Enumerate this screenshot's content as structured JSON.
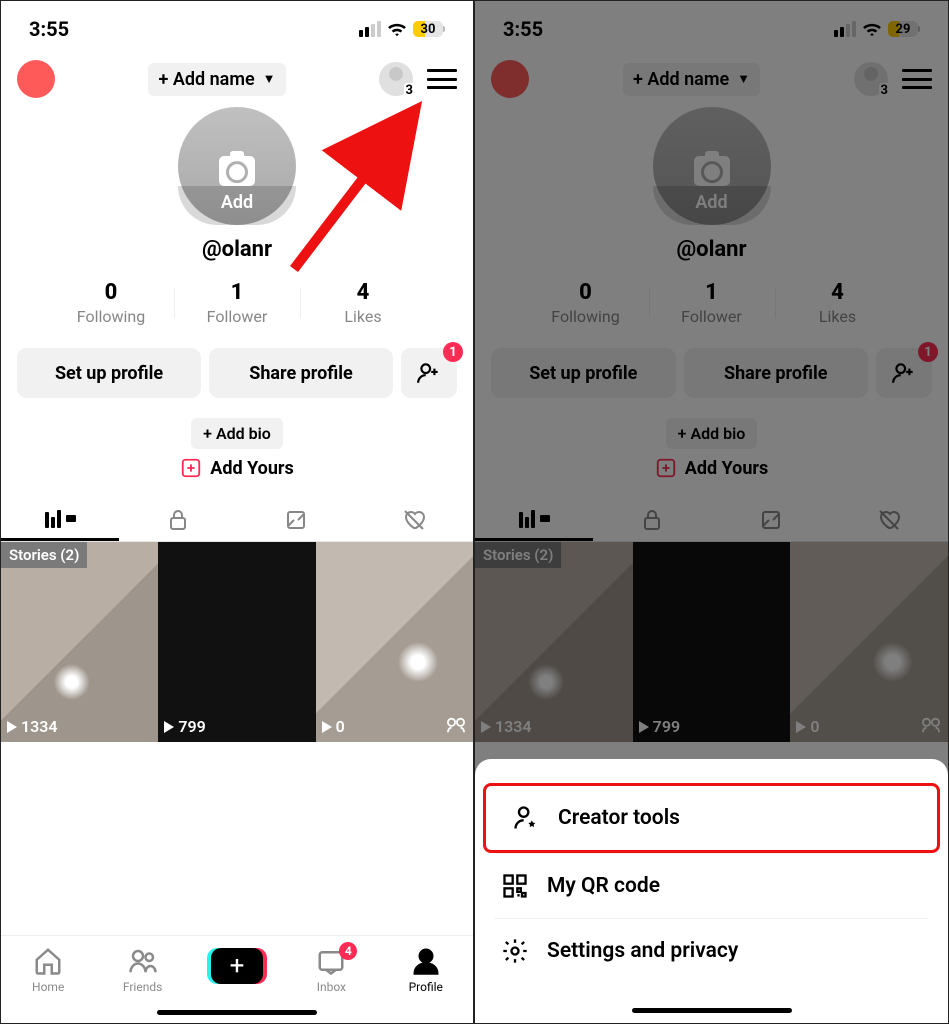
{
  "left": {
    "status": {
      "time": "3:55",
      "battery": "30"
    },
    "nav": {
      "add_name": "+ Add name",
      "acct_count": "3"
    },
    "profile": {
      "avatar_add": "Add",
      "username": "@olanr",
      "stats": [
        {
          "num": "0",
          "lbl": "Following"
        },
        {
          "num": "1",
          "lbl": "Follower"
        },
        {
          "num": "4",
          "lbl": "Likes"
        }
      ],
      "setup": "Set up profile",
      "share": "Share profile",
      "add_friend_badge": "1",
      "add_bio": "+ Add bio",
      "add_yours": "Add Yours"
    },
    "grid": {
      "stories_label": "Stories (2)",
      "thumbs": [
        {
          "plays": "1334"
        },
        {
          "plays": "799"
        },
        {
          "plays": "0"
        }
      ]
    },
    "tabbar": {
      "home": "Home",
      "friends": "Friends",
      "inbox": "Inbox",
      "inbox_badge": "4",
      "profile": "Profile"
    }
  },
  "right": {
    "status": {
      "time": "3:55",
      "battery": "29"
    },
    "menu": {
      "creator_tools": "Creator tools",
      "qr": "My QR code",
      "settings": "Settings and privacy"
    }
  }
}
